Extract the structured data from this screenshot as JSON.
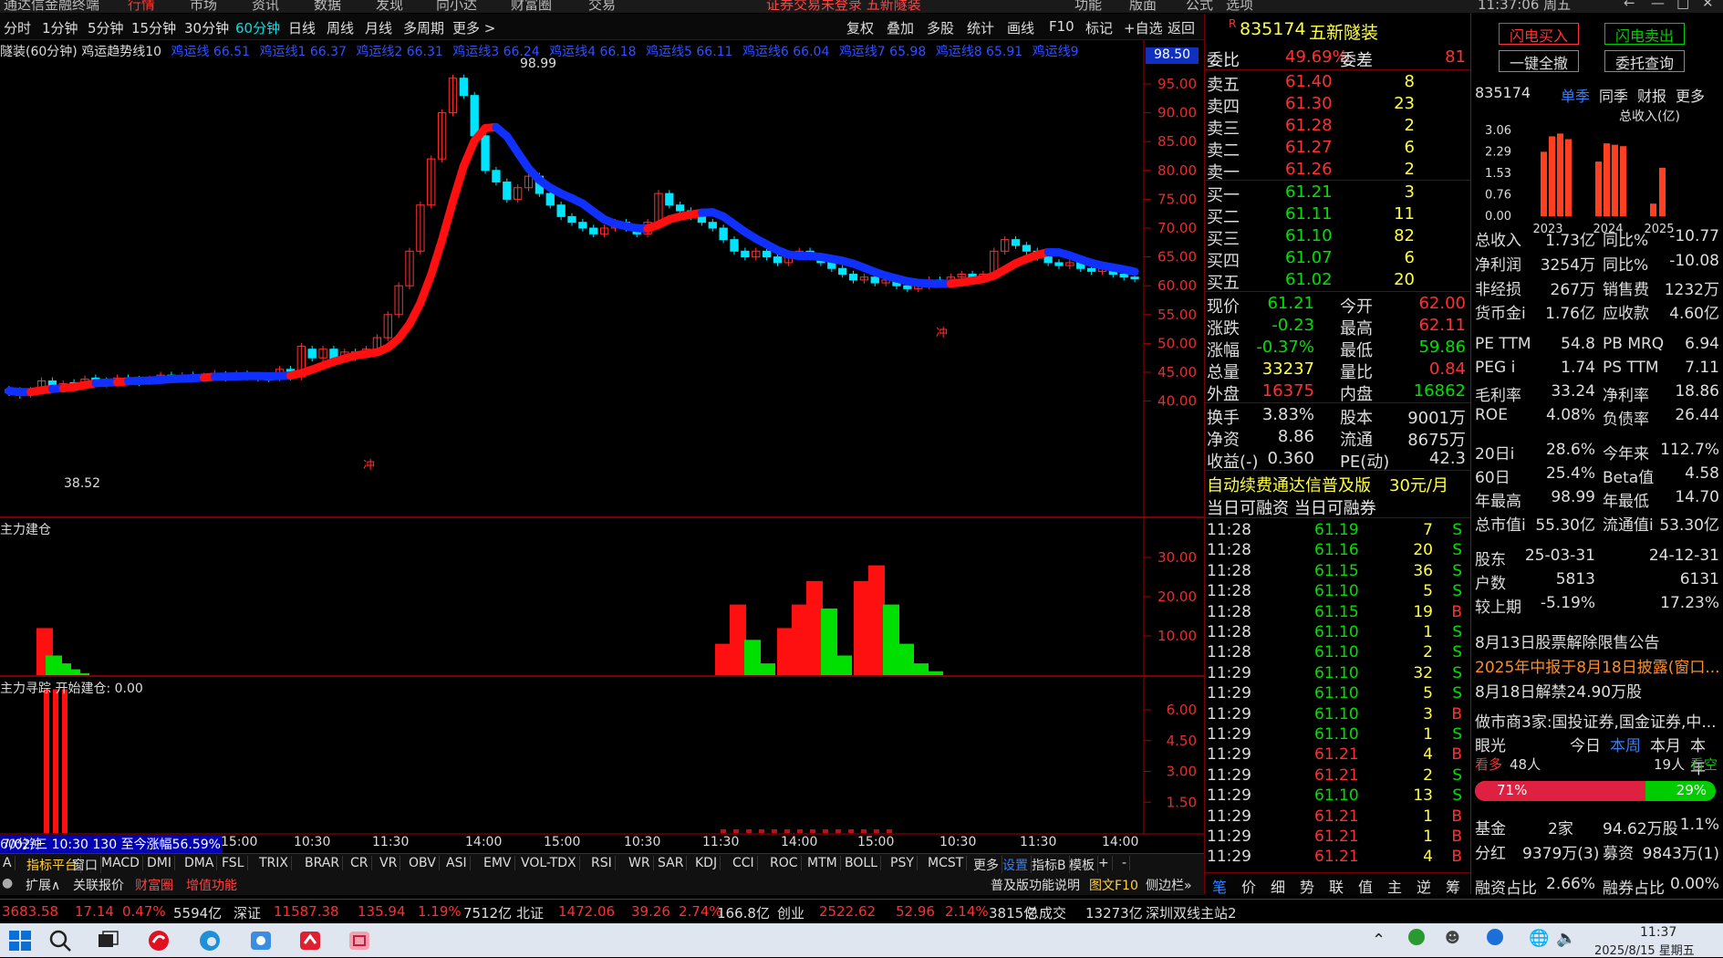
{
  "topbar": {
    "items": [
      "通达信金融终端",
      "行情",
      "市场",
      "资讯",
      "数据",
      "发现",
      "向小达",
      "财富圈",
      "交易",
      "证券交易未登录  五新隧装",
      "功能",
      "版面",
      "公式",
      "选项",
      "11:37:06 周五"
    ]
  },
  "periods": [
    "分时",
    "1分钟",
    "5分钟",
    "15分钟",
    "30分钟",
    "60分钟",
    "日线",
    "周线",
    "月线",
    "多周期",
    "更多 >"
  ],
  "tools": [
    "复权",
    "叠加",
    "多股",
    "统计",
    "画线",
    "F10",
    "标记",
    "+自选",
    "返回"
  ],
  "indicator_line": {
    "title": "隧装(60分钟)",
    "name": "鸡运趋势线10",
    "values": [
      "鸡运线 66.51",
      "鸡运线1 66.37",
      "鸡运线2 66.31",
      "鸡运线3 66.24",
      "鸡运线4 66.18",
      "鸡运线5 66.11",
      "鸡运线6 66.04",
      "鸡运线7 65.98",
      "鸡运线8 65.91",
      "鸡运线9"
    ]
  },
  "chart_data": {
    "type": "candlestick",
    "price_axis": {
      "ticks": [
        "95.00",
        "90.00",
        "85.00",
        "80.00",
        "75.00",
        "70.00",
        "65.00",
        "60.00",
        "55.00",
        "50.00",
        "45.00",
        "40.00"
      ],
      "current": "98.50"
    },
    "high_label": "98.99",
    "low_label": "38.52",
    "markers": [
      "冲",
      "冲"
    ],
    "time_axis": [
      "7/02/三 10:30 130 至今涨幅56.59%",
      "15:00",
      "10:30",
      "11:30",
      "14:00",
      "15:00",
      "10:30",
      "11:30",
      "14:00",
      "15:00",
      "10:30",
      "11:30",
      "14:00",
      "60分钟"
    ],
    "sub1": {
      "title": "主力建仓",
      "ticks": [
        "30.00",
        "20.00",
        "10.00"
      ]
    },
    "sub2": {
      "title": "主力寻踪",
      "subtitle": "开始建仓: 0.00",
      "ticks": [
        "6.00",
        "4.50",
        "3.00",
        "1.50"
      ]
    }
  },
  "indicator_tabs": [
    "A",
    "指标平台",
    "窗口",
    "MACD",
    "DMI",
    "DMA",
    "FSL",
    "TRIX",
    "BRAR",
    "CR",
    "VR",
    "OBV",
    "ASI",
    "EMV",
    "VOL-TDX",
    "RSI",
    "WR",
    "SAR",
    "KDJ",
    "CCI",
    "ROC",
    "MTM",
    "BOLL",
    "PSY",
    "MCST",
    "更多",
    "设置",
    "指标B",
    "模板",
    "+",
    "-"
  ],
  "bottom_links": [
    "扩展∧",
    "关联报价",
    "财富圈",
    "增值功能",
    "普及版功能说明",
    "图文F10",
    "侧边栏»"
  ],
  "quote": {
    "code": "835174",
    "name": "五新隧装",
    "weibi_label": "委比",
    "weibi": "49.69%",
    "weicha_label": "委差",
    "weicha": "81",
    "asks": [
      {
        "l": "卖五",
        "p": "61.40",
        "v": "8"
      },
      {
        "l": "卖四",
        "p": "61.30",
        "v": "23"
      },
      {
        "l": "卖三",
        "p": "61.28",
        "v": "2"
      },
      {
        "l": "卖二",
        "p": "61.27",
        "v": "6"
      },
      {
        "l": "卖一",
        "p": "61.26",
        "v": "2"
      }
    ],
    "bids": [
      {
        "l": "买一",
        "p": "61.21",
        "v": "3"
      },
      {
        "l": "买二",
        "p": "61.11",
        "v": "11"
      },
      {
        "l": "买三",
        "p": "61.10",
        "v": "82"
      },
      {
        "l": "买四",
        "p": "61.07",
        "v": "6"
      },
      {
        "l": "买五",
        "p": "61.02",
        "v": "20"
      }
    ],
    "stats": [
      {
        "a": "现价",
        "av": "61.21",
        "b": "今开",
        "bv": "62.00"
      },
      {
        "a": "涨跌",
        "av": "-0.23",
        "b": "最高",
        "bv": "62.11"
      },
      {
        "a": "涨幅",
        "av": "-0.37%",
        "b": "最低",
        "bv": "59.86"
      },
      {
        "a": "总量",
        "av": "33237",
        "b": "量比",
        "bv": "0.84"
      },
      {
        "a": "外盘",
        "av": "16375",
        "b": "内盘",
        "bv": "16862"
      }
    ],
    "stats2": [
      {
        "a": "换手",
        "av": "3.83%",
        "b": "股本",
        "bv": "9001万"
      },
      {
        "a": "净资",
        "av": "8.86",
        "b": "流通",
        "bv": "8675万"
      },
      {
        "a": "收益(-)",
        "av": "0.360",
        "b": "PE(动)",
        "bv": "42.3"
      }
    ],
    "promo": "自动续费通达信普及版",
    "promo_price": "30元/月",
    "margin": "当日可融资 当日可融券",
    "trades": [
      {
        "t": "11:28",
        "p": "61.19",
        "v": "7",
        "s": "S"
      },
      {
        "t": "11:28",
        "p": "61.16",
        "v": "20",
        "s": "S"
      },
      {
        "t": "11:28",
        "p": "61.15",
        "v": "36",
        "s": "S"
      },
      {
        "t": "11:28",
        "p": "61.10",
        "v": "5",
        "s": "S"
      },
      {
        "t": "11:28",
        "p": "61.15",
        "v": "19",
        "s": "B"
      },
      {
        "t": "11:28",
        "p": "61.10",
        "v": "1",
        "s": "S"
      },
      {
        "t": "11:28",
        "p": "61.10",
        "v": "2",
        "s": "S"
      },
      {
        "t": "11:29",
        "p": "61.10",
        "v": "32",
        "s": "S"
      },
      {
        "t": "11:29",
        "p": "61.10",
        "v": "5",
        "s": "S"
      },
      {
        "t": "11:29",
        "p": "61.10",
        "v": "3",
        "s": "B"
      },
      {
        "t": "11:29",
        "p": "61.10",
        "v": "1",
        "s": "S"
      },
      {
        "t": "11:29",
        "p": "61.21",
        "v": "4",
        "s": "B"
      },
      {
        "t": "11:29",
        "p": "61.21",
        "v": "2",
        "s": "S"
      },
      {
        "t": "11:29",
        "p": "61.10",
        "v": "13",
        "s": "S"
      },
      {
        "t": "11:29",
        "p": "61.21",
        "v": "1",
        "s": "B"
      },
      {
        "t": "11:29",
        "p": "61.21",
        "v": "1",
        "s": "B"
      },
      {
        "t": "11:29",
        "p": "61.21",
        "v": "4",
        "s": "B"
      }
    ],
    "bottom_tabs": [
      "笔",
      "价",
      "细",
      "势",
      "联",
      "值",
      "主",
      "逆",
      "筹"
    ]
  },
  "fin": {
    "btn_buy": "闪电买入",
    "btn_sell": "闪电卖出",
    "btn_cancel": "一键全撤",
    "btn_query": "委托查询",
    "code": "835174",
    "tabs": [
      "单季",
      "同季",
      "财报",
      "更多"
    ],
    "chart_title": "总收入(亿)",
    "yticks": [
      "3.06",
      "2.29",
      "1.53",
      "0.76",
      "0.00"
    ],
    "years": [
      "2023",
      "2024",
      "2025"
    ],
    "bars": [
      2.3,
      2.85,
      2.95,
      2.75,
      1.95,
      2.6,
      2.55,
      2.5,
      0.45,
      1.73
    ],
    "rows": [
      {
        "a": "总收入",
        "av": "1.73亿",
        "b": "同比%",
        "bv": "-10.77"
      },
      {
        "a": "净利润",
        "av": "3254万",
        "b": "同比%",
        "bv": "-10.08"
      },
      {
        "a": "非经损",
        "av": "267万",
        "b": "销售费",
        "bv": "1232万"
      },
      {
        "a": "货币金i",
        "av": "1.76亿",
        "b": "应收款",
        "bv": "4.60亿"
      },
      {
        "a": "PE TTM",
        "av": "54.8",
        "b": "PB MRQ",
        "bv": "6.94"
      },
      {
        "a": "PEG i",
        "av": "1.74",
        "b": "PS TTM",
        "bv": "7.11"
      },
      {
        "a": "毛利率",
        "av": "33.24",
        "b": "净利率",
        "bv": "18.86"
      },
      {
        "a": "ROE",
        "av": "4.08%",
        "b": "负债率",
        "bv": "26.44"
      },
      {
        "a": "20日i",
        "av": "28.6%",
        "b": "今年来",
        "bv": "112.7%"
      },
      {
        "a": "60日",
        "av": "25.4%",
        "b": "Beta值",
        "bv": "4.58"
      },
      {
        "a": "年最高",
        "av": "98.99",
        "b": "年最低",
        "bv": "14.70"
      },
      {
        "a": "总市值i",
        "av": "55.30亿",
        "b": "流通值i",
        "bv": "53.30亿"
      },
      {
        "a": "股东",
        "av": "25-03-31",
        "b": "",
        "bv": "24-12-31"
      },
      {
        "a": "户数",
        "av": "5813",
        "b": "",
        "bv": "6131"
      },
      {
        "a": "较上期",
        "av": "-5.19%",
        "b": "",
        "bv": "17.23%"
      }
    ],
    "news": [
      "8月13日股票解除限售公告",
      "2025年中报于8月18日披露(窗口...",
      "8月18日解禁24.90万股",
      "做市商3家:国投证券,国金证券,中..."
    ],
    "eye": {
      "label": "眼光",
      "tabs": [
        "今日",
        "本周",
        "本月",
        "本年"
      ],
      "bull": "看多",
      "bull_n": "48人",
      "bear_n": "19人",
      "bear": "看空",
      "bull_pct": "71%",
      "bear_pct": "29%"
    },
    "fund": {
      "a": "基金",
      "b": "2家",
      "c": "94.62万股",
      "d": "1.1%"
    },
    "div": {
      "a": "分红",
      "b": "9379万(3)",
      "c": "募资",
      "d": "9843万(1)"
    },
    "rz": {
      "a": "融资占比",
      "b": "2.66%",
      "c": "融券占比",
      "d": "0.00%"
    }
  },
  "indexbar": [
    {
      "t": "3683.58",
      "c": "red"
    },
    {
      "t": "17.14",
      "c": "red"
    },
    {
      "t": "0.47%",
      "c": "red"
    },
    {
      "t": "5594亿",
      "c": "wht"
    },
    {
      "t": "深证",
      "c": "wht"
    },
    {
      "t": "11587.38",
      "c": "red"
    },
    {
      "t": "135.94",
      "c": "red"
    },
    {
      "t": "1.19%",
      "c": "red"
    },
    {
      "t": "7512亿",
      "c": "wht"
    },
    {
      "t": "北证",
      "c": "wht"
    },
    {
      "t": "1472.06",
      "c": "red"
    },
    {
      "t": "39.26",
      "c": "red"
    },
    {
      "t": "2.74%",
      "c": "red"
    },
    {
      "t": "166.8亿",
      "c": "wht"
    },
    {
      "t": "创业",
      "c": "wht"
    },
    {
      "t": "2522.62",
      "c": "red"
    },
    {
      "t": "52.96",
      "c": "red"
    },
    {
      "t": "2.14%",
      "c": "red"
    },
    {
      "t": "3815亿",
      "c": "wht"
    },
    {
      "t": "总成交",
      "c": "wht"
    },
    {
      "t": "13273亿",
      "c": "wht"
    },
    {
      "t": "深圳双线主站2",
      "c": "wht"
    }
  ],
  "taskbar": {
    "time": "11:37",
    "date": "2025/8/15 星期五"
  }
}
